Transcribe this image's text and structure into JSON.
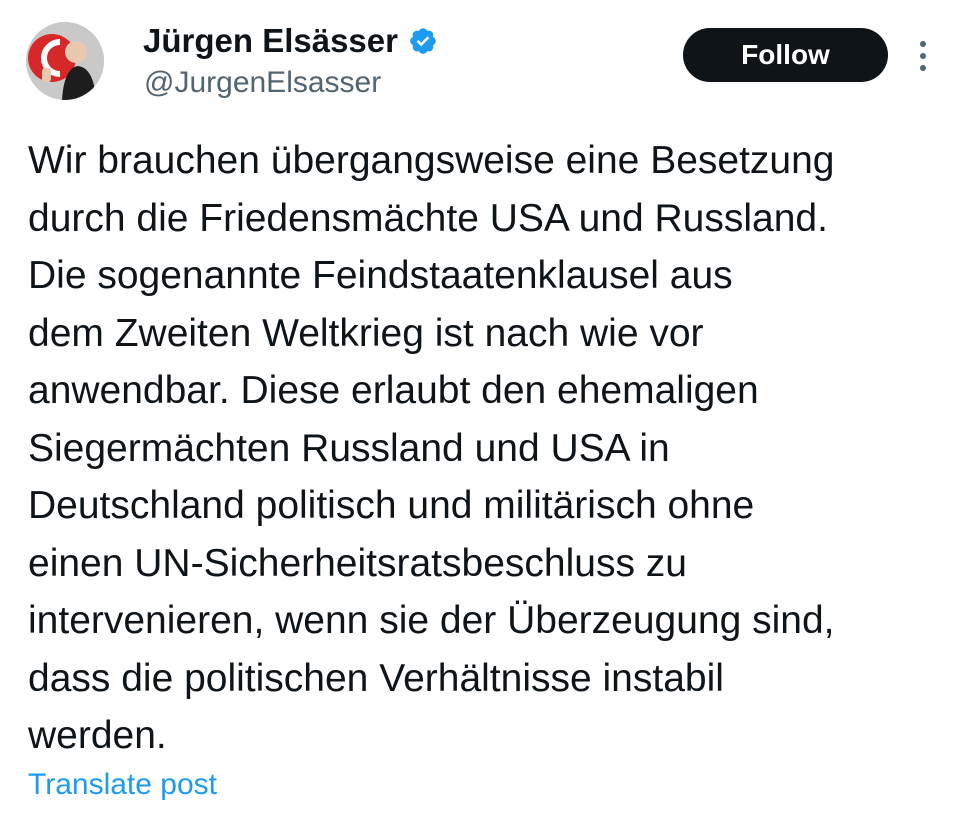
{
  "author": {
    "display_name": "Jürgen Elsässer",
    "handle": "@JurgenElsasser",
    "verified": true,
    "avatar_icon": "avatar-photo",
    "verified_icon": "verified-badge-icon",
    "verified_color": "#1d9bf0"
  },
  "actions": {
    "follow_label": "Follow",
    "more_icon": "more-options-icon",
    "translate_label": "Translate post"
  },
  "post": {
    "lines": [
      "Wir brauchen übergangsweise eine Besetzung",
      "durch die Friedensmächte USA und Russland.",
      "Die sogenannte Feindstaatenklausel aus",
      "dem Zweiten Weltkrieg ist nach wie vor",
      "anwendbar. Diese erlaubt den ehemaligen",
      "Siegermächten Russland und USA in",
      "Deutschland politisch und militärisch ohne",
      "einen UN-Sicherheitsratsbeschluss zu",
      "intervenieren, wenn sie der Überzeugung sind,",
      "dass die politischen Verhältnisse instabil",
      "werden."
    ]
  },
  "colors": {
    "text": "#0f1419",
    "secondary": "#536471",
    "link": "#1d9bf0",
    "button_bg": "#0f1419",
    "button_text": "#ffffff"
  }
}
